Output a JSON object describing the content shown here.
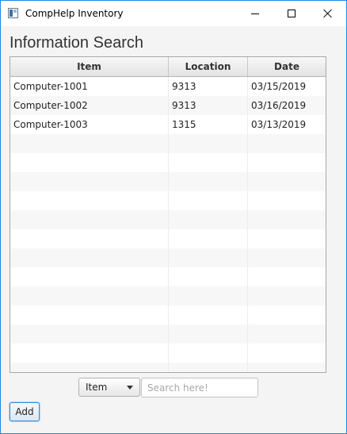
{
  "window": {
    "title": "CompHelp Inventory",
    "icon": "app-window-icon",
    "controls": [
      "minimize-icon",
      "maximize-icon",
      "close-icon"
    ]
  },
  "page": {
    "title": "Information Search"
  },
  "table": {
    "columns": [
      "Item",
      "Location",
      "Date"
    ],
    "rows": [
      [
        "Computer-1001",
        "9313",
        "03/15/2019"
      ],
      [
        "Computer-1002",
        "9313",
        "03/16/2019"
      ],
      [
        "Computer-1003",
        "1315",
        "03/13/2019"
      ]
    ]
  },
  "search": {
    "filter_selected": "Item",
    "placeholder": "Search here!",
    "value": ""
  },
  "actions": {
    "add_label": "Add"
  },
  "colors": {
    "window_border": "#1e88e5",
    "background": "#f4f4f4",
    "row_alt": "#f7f7f7",
    "focus_border": "#3f8fd4"
  }
}
